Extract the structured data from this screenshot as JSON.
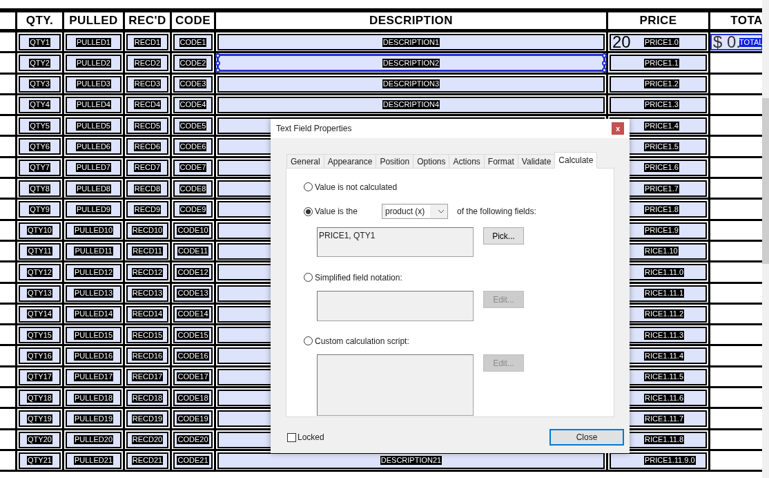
{
  "table": {
    "columns": [
      "QTY.",
      "PULLED",
      "REC'D",
      "CODE",
      "DESCRIPTION",
      "PRICE",
      "TOTA"
    ],
    "rows": [
      {
        "qty": "QTY1",
        "pulled": "PULLED1",
        "recd": "RECD1",
        "code": "CODE1",
        "description": "DESCRIPTION1",
        "description_selected": false,
        "price_value": "20",
        "price": "PRICE1.0",
        "total": {
          "value": "$ 0.",
          "label": "TOTAL",
          "selected": true
        }
      },
      {
        "qty": "QTY2",
        "pulled": "PULLED2",
        "recd": "RECD2",
        "code": "CODE2",
        "description": "DESCRIPTION2",
        "description_selected": true,
        "price": "PRICE1.1"
      },
      {
        "qty": "QTY3",
        "pulled": "PULLED3",
        "recd": "RECD3",
        "code": "CODE3",
        "description": "DESCRIPTION3",
        "description_selected": false,
        "price": "PRICE1.2"
      },
      {
        "qty": "QTY4",
        "pulled": "PULLED4",
        "recd": "RECD4",
        "code": "CODE4",
        "description": "DESCRIPTION4",
        "description_selected": false,
        "price": "PRICE1.3"
      },
      {
        "qty": "QTY5",
        "pulled": "PULLED5",
        "recd": "RECD5",
        "code": "CODE5",
        "description_selected": false,
        "price": "PRICE1.4"
      },
      {
        "qty": "QTY6",
        "pulled": "PULLED6",
        "recd": "RECD6",
        "code": "CODE6",
        "description_selected": false,
        "price": "PRICE1.5"
      },
      {
        "qty": "QTY7",
        "pulled": "PULLED7",
        "recd": "RECD7",
        "code": "CODE7",
        "description_selected": false,
        "price": "PRICE1.6"
      },
      {
        "qty": "QTY8",
        "pulled": "PULLED8",
        "recd": "RECD8",
        "code": "CODE8",
        "description_selected": false,
        "price": "PRICE1.7"
      },
      {
        "qty": "QTY9",
        "pulled": "PULLED9",
        "recd": "RECD9",
        "code": "CODE9",
        "description_selected": false,
        "price": "PRICE1.8"
      },
      {
        "qty": "QTY10",
        "pulled": "PULLED10",
        "recd": "RECD10",
        "code": "CODE10",
        "description_selected": false,
        "price": "PRICE1.9"
      },
      {
        "qty": "QTY11",
        "pulled": "PULLED11",
        "recd": "RECD11",
        "code": "CODE11",
        "description_selected": false,
        "price": "RICE1.10"
      },
      {
        "qty": "QTY12",
        "pulled": "PULLED12",
        "recd": "RECD12",
        "code": "CODE12",
        "description_selected": false,
        "price": "RICE1.11.0"
      },
      {
        "qty": "QTY13",
        "pulled": "PULLED13",
        "recd": "RECD13",
        "code": "CODE13",
        "description_selected": false,
        "price": "RICE1.11.1"
      },
      {
        "qty": "QTY14",
        "pulled": "PULLED14",
        "recd": "RECD14",
        "code": "CODE14",
        "description_selected": false,
        "price": "RICE1.11.2"
      },
      {
        "qty": "QTY15",
        "pulled": "PULLED15",
        "recd": "RECD15",
        "code": "CODE15",
        "description_selected": false,
        "price": "RICE1.11.3"
      },
      {
        "qty": "QTY16",
        "pulled": "PULLED16",
        "recd": "RECD16",
        "code": "CODE16",
        "description_selected": false,
        "price": "RICE1.11.4"
      },
      {
        "qty": "QTY17",
        "pulled": "PULLED17",
        "recd": "RECD17",
        "code": "CODE17",
        "description_selected": false,
        "price": "RICE1.11.5"
      },
      {
        "qty": "QTY18",
        "pulled": "PULLED18",
        "recd": "RECD18",
        "code": "CODE18",
        "description_selected": false,
        "price": "RICE1.11.6"
      },
      {
        "qty": "QTY19",
        "pulled": "PULLED19",
        "recd": "RECD19",
        "code": "CODE19",
        "description_selected": false,
        "price": "RICE1.11.7"
      },
      {
        "qty": "QTY20",
        "pulled": "PULLED20",
        "recd": "RECD20",
        "code": "CODE20",
        "description_selected": false,
        "price": "RICE1.11.8"
      },
      {
        "qty": "QTY21",
        "pulled": "PULLED21",
        "recd": "RECD21",
        "code": "CODE21",
        "description": "DESCRIPTION21",
        "description_selected": false,
        "price": "PRICE1.11.9.0"
      }
    ]
  },
  "dialog": {
    "title": "Text Field Properties",
    "close": "x",
    "tabs": [
      {
        "label": "General",
        "selected": false
      },
      {
        "label": "Appearance",
        "selected": false
      },
      {
        "label": "Position",
        "selected": false
      },
      {
        "label": "Options",
        "selected": false
      },
      {
        "label": "Actions",
        "selected": false
      },
      {
        "label": "Format",
        "selected": false
      },
      {
        "label": "Validate",
        "selected": false
      },
      {
        "label": "Calculate",
        "selected": true
      }
    ],
    "options": [
      {
        "kind": "plain",
        "label": "Value is not calculated",
        "selected": false
      },
      {
        "kind": "operation",
        "label": "Value is the",
        "selected": true,
        "operation": "product (x)",
        "suffix": "of the following fields:",
        "fields": "PRICE1, QTY1",
        "button": {
          "label": "Pick...",
          "disabled": false
        }
      },
      {
        "kind": "script",
        "label": "Simplified field notation:",
        "selected": false,
        "tall": false,
        "button": {
          "label": "Edit...",
          "disabled": true
        }
      },
      {
        "kind": "script",
        "label": "Custom calculation script:",
        "selected": false,
        "tall": true,
        "button": {
          "label": "Edit...",
          "disabled": true
        }
      }
    ],
    "locked": {
      "label": "Locked",
      "checked": false
    },
    "close_button": "Close"
  }
}
